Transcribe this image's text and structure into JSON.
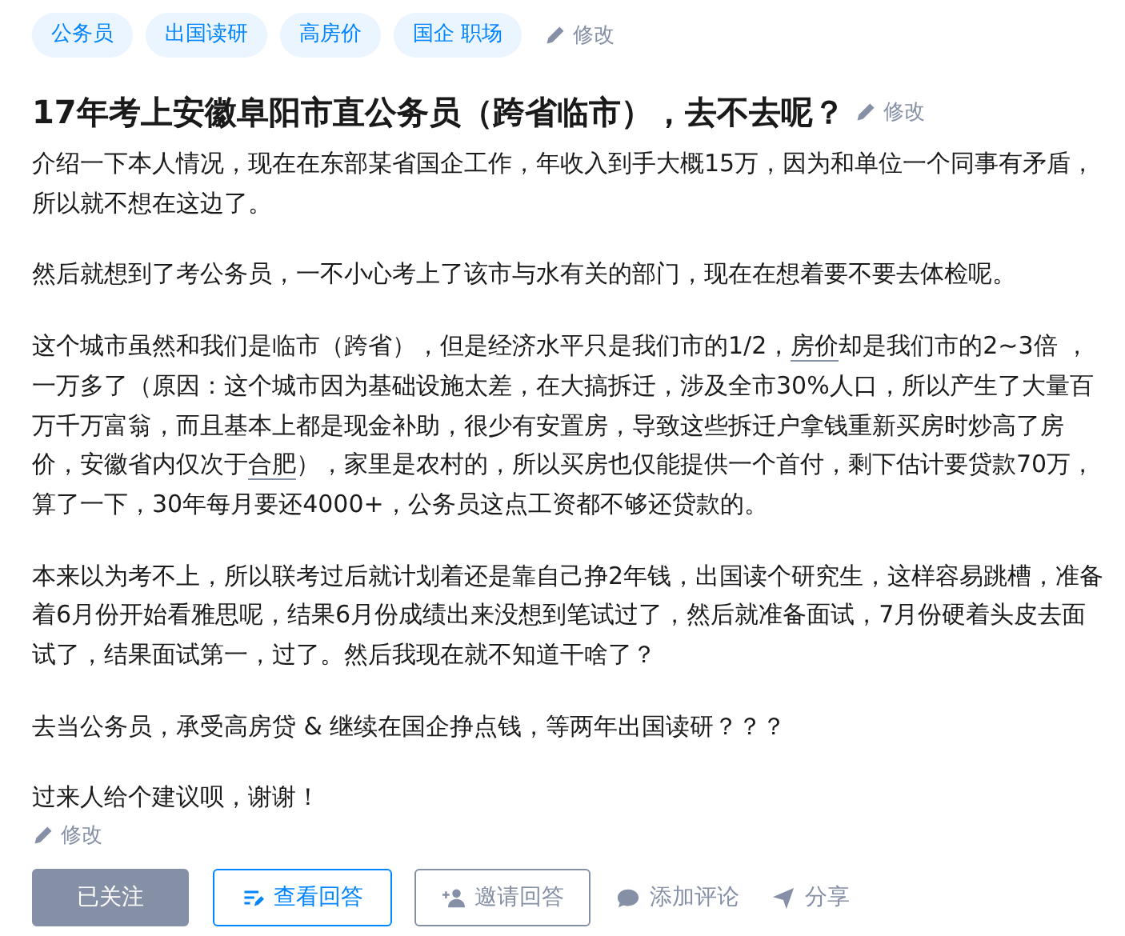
{
  "topics": [
    {
      "label": "公务员"
    },
    {
      "label": "出国读研"
    },
    {
      "label": "高房价"
    },
    {
      "label": "国企 职场"
    }
  ],
  "topic_edit": "修改",
  "question": {
    "title": "17年考上安徽阜阳市直公务员（跨省临市），去不去呢？",
    "edit": "修改"
  },
  "paragraphs": [
    [
      {
        "kind": "text",
        "text": "介绍一下本人情况，现在在东部某省国企工作，年收入到手大概15万，因为和单位一个同事有矛盾，所以就不想在这边了。"
      }
    ],
    [
      {
        "kind": "text",
        "text": "然后就想到了考公务员，一不小心考上了该市与水有关的部门，现在在想着要不要去体检呢。"
      }
    ],
    [
      {
        "kind": "text",
        "text": "这个城市虽然和我们是临市（跨省），但是经济水平只是我们市的1/2，"
      },
      {
        "kind": "link",
        "text": "房价"
      },
      {
        "kind": "text",
        "text": "却是我们市的2~3倍 ，一万多了（原因：这个城市因为基础设施太差，在大搞拆迁，涉及全市30%人口，所以产生了大量百万千万富翁，而且基本上都是现金补助，很少有安置房，导致这些拆迁户拿钱重新买房时炒高了房价，安徽省内仅次于"
      },
      {
        "kind": "link",
        "text": "合肥"
      },
      {
        "kind": "text",
        "text": "），家里是农村的，所以买房也仅能提供一个首付，剩下估计要贷款70万，算了一下，30年每月要还4000+，公务员这点工资都不够还贷款的。"
      }
    ],
    [
      {
        "kind": "text",
        "text": "本来以为考不上，所以联考过后就计划着还是靠自己挣2年钱，出国读个研究生，这样容易跳槽，准备着6月份开始看雅思呢，结果6月份成绩出来没想到笔试过了，然后就准备面试，7月份硬着头皮去面试了，结果面试第一，过了。然后我现在就不知道干啥了？"
      }
    ],
    [
      {
        "kind": "text",
        "text": "去当公务员，承受高房贷 & 继续在国企挣点钱，等两年出国读研？？？"
      }
    ],
    [
      {
        "kind": "text",
        "text": "过来人给个建议呗，谢谢！"
      }
    ]
  ],
  "body_edit": "修改",
  "actions": [
    {
      "kind": "followed",
      "label": "已关注"
    },
    {
      "kind": "view",
      "label": "查看回答"
    },
    {
      "kind": "invite",
      "label": "邀请回答"
    },
    {
      "kind": "comment",
      "label": "添加评论"
    },
    {
      "kind": "share",
      "label": "分享"
    }
  ]
}
